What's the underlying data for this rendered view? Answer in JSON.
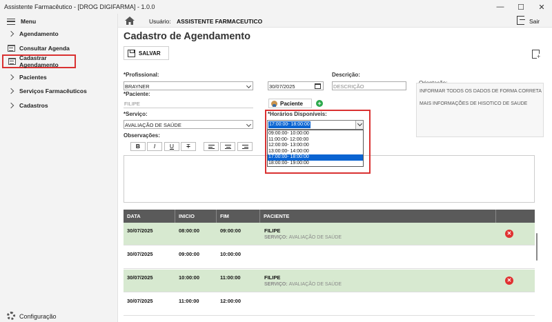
{
  "window": {
    "title": "Assistente Farmacêutico - [DROG DIGIFARMA] - 1.0.0",
    "controls": [
      "minimize-icon",
      "maximize-icon",
      "close-icon"
    ]
  },
  "sidebar": {
    "menu_label": "Menu",
    "items": [
      {
        "label": "Agendamento",
        "icon": "chevron-right-icon"
      },
      {
        "label": "Consultar Agenda",
        "icon": "calendar-icon"
      },
      {
        "label": "Cadastrar Agendamento",
        "icon": "calendar-icon",
        "active": true
      },
      {
        "label": "Pacientes",
        "icon": "chevron-right-icon"
      },
      {
        "label": "Serviços Farmacêuticos",
        "icon": "chevron-right-icon"
      },
      {
        "label": "Cadastros",
        "icon": "chevron-right-icon"
      }
    ],
    "config_label": "Configuração"
  },
  "topbar": {
    "user_label": "Usuário:",
    "user_name": "ASSISTENTE FARMACEUTICO",
    "logout_label": "Sair"
  },
  "page": {
    "title": "Cadastro de Agendamento",
    "save_label": "SALVAR"
  },
  "form": {
    "profissional_label": "*Profissional:",
    "profissional_value": "BRAYNER",
    "date_value": "30/07/2025",
    "descricao_label": "Descrição:",
    "descricao_placeholder": "DESCRIÇÃO",
    "paciente_label": "*Paciente:",
    "paciente_value": "FILIPE",
    "paciente_button": "Paciente",
    "add_button": "+",
    "servico_label": "*Serviço:",
    "servico_value": "AVALIAÇÃO DE SAÚDE",
    "observacoes_label": "Observações:",
    "orientacao_label": "Orientação:",
    "orientacao_lines": [
      "INFORMAR TODOS OS DADOS DE FORMA CORRETA",
      "MAIS INFORMAÇÕES DE HISOTICO DE SAUDE"
    ],
    "format_buttons": [
      "B",
      "I",
      "U",
      "T"
    ]
  },
  "horarios": {
    "label": "*Horários Disponíveis:",
    "selected": "17:00:00- 18:00:00",
    "options": [
      "09:00:00- 10:00:00",
      "11:00:00- 12:00:00",
      "12:00:00- 13:00:00",
      "13:00:00- 14:00:00",
      "17:00:00- 18:00:00",
      "18:00:00- 19:00:00"
    ]
  },
  "table": {
    "columns": [
      "DATA",
      "INICIO",
      "FIM",
      "PACIENTE"
    ],
    "rows": [
      {
        "data": "30/07/2025",
        "inicio": "08:00:00",
        "fim": "09:00:00",
        "paciente": "FILIPE",
        "servico_label": "SERVIÇO:",
        "servico": "AVALIAÇÃO DE SAÚDE",
        "booked": true
      },
      {
        "data": "30/07/2025",
        "inicio": "09:00:00",
        "fim": "10:00:00",
        "paciente": "",
        "servico_label": "",
        "servico": "",
        "booked": false
      },
      {
        "data": "30/07/2025",
        "inicio": "10:00:00",
        "fim": "11:00:00",
        "paciente": "FILIPE",
        "servico_label": "SERVIÇO:",
        "servico": "AVALIAÇÃO DE SAÚDE",
        "booked": true
      },
      {
        "data": "30/07/2025",
        "inicio": "11:00:00",
        "fim": "12:00:00",
        "paciente": "",
        "servico_label": "",
        "servico": "",
        "booked": false
      }
    ]
  },
  "colors": {
    "highlight_red": "#d93030",
    "booked_row": "#d7e9d0",
    "table_header": "#5a5a5a",
    "selection_blue": "#0a64d2",
    "delete_red": "#e03131",
    "add_green": "#2aa84a"
  }
}
